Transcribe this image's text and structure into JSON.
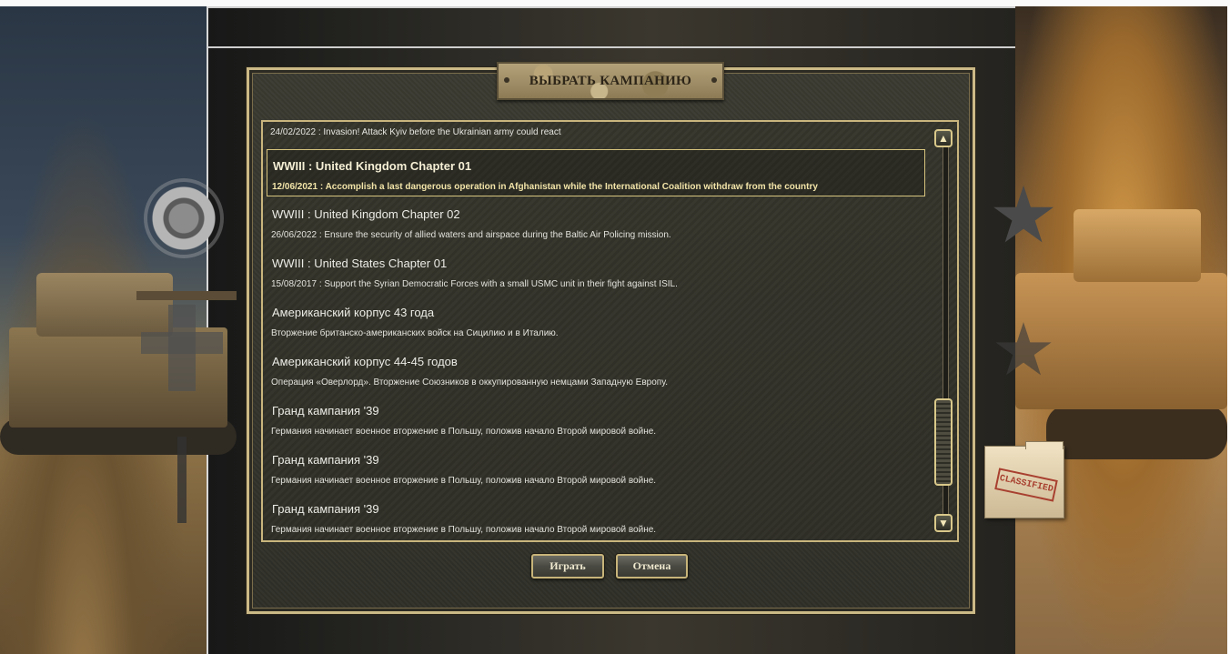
{
  "dialog": {
    "title": "ВЫБРАТЬ КАМПАНИЮ",
    "top_entry": "24/02/2022 : Invasion! Attack Kyiv before the Ukrainian army could react",
    "campaigns": [
      {
        "title": "WWIII : United Kingdom Chapter 01",
        "description": "12/06/2021 : Accomplish a last dangerous operation in Afghanistan while the International Coalition withdraw from the country",
        "selected": true
      },
      {
        "title": "WWIII : United Kingdom Chapter 02",
        "description": "26/06/2022 : Ensure the security of allied waters and airspace during the Baltic Air Policing mission."
      },
      {
        "title": "WWIII : United States Chapter 01",
        "description": "15/08/2017 : Support the Syrian Democratic Forces with a small USMC unit in their fight against ISIL."
      },
      {
        "title": "Американский корпус 43 года",
        "description": "Вторжение британско-американских войск на Сицилию и в Италию."
      },
      {
        "title": "Американский корпус 44-45 годов",
        "description": "Операция «Оверлорд». Вторжение Союзников в оккупированную немцами Западную Европу."
      },
      {
        "title": "Гранд кампания '39",
        "description": "Германия начинает военное вторжение в Польшу, положив начало Второй мировой войне."
      },
      {
        "title": "Гранд кампания '39",
        "description": "Германия начинает военное вторжение в Польшу, положив начало Второй мировой войне."
      },
      {
        "title": "Гранд кампания '39",
        "description": "Германия начинает военное вторжение в Польшу, положив начало Второй мировой войне."
      }
    ],
    "buttons": {
      "play": "Играть",
      "cancel": "Отмена"
    },
    "scroll_up_icon": "▲",
    "scroll_down_icon": "▼"
  },
  "folder_stamp": "CLASSIFIED",
  "icons": [
    "gear-icon",
    "star-icon",
    "cross-icon",
    "palm-icon",
    "folder-icon"
  ],
  "colors": {
    "frame": "#cbb986",
    "panel": "#35352d",
    "selected_text": "#f2e4a8"
  }
}
